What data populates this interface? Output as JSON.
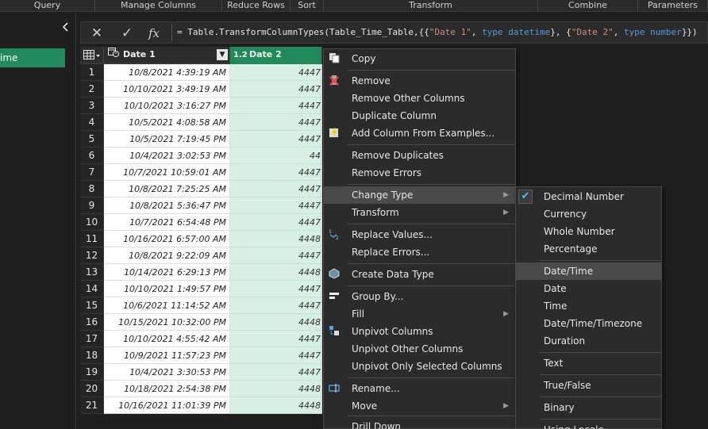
{
  "ribbon": {
    "groups": [
      "Query",
      "Manage Columns",
      "Reduce Rows",
      "Sort",
      "Transform",
      "Combine",
      "Parameters"
    ]
  },
  "queries": {
    "collapse_icon": "chevron-left",
    "selected_item": "ime"
  },
  "formula_bar": {
    "cancel_icon": "✕",
    "commit_icon": "✓",
    "fx_label": "fx",
    "eq": "=",
    "fn": "Table.TransformColumnTypes(Table_Time_Table,{{",
    "s1": "\"Date 1\"",
    "c1": ", ",
    "t1": "type datetime",
    "c2": "}, {",
    "s2": "\"Date 2\"",
    "c3": ", ",
    "t2": "type number",
    "c4": "}})"
  },
  "table": {
    "corner_icon": "table-menu-icon",
    "columns": [
      {
        "type_label": "",
        "name": "Date 1"
      },
      {
        "type_label": "1.2",
        "name": "Date 2"
      }
    ],
    "rows": [
      {
        "n": "1",
        "d1": "10/8/2021 4:39:19 AM",
        "d2": "4447"
      },
      {
        "n": "2",
        "d1": "10/10/2021 3:49:19 AM",
        "d2": "4447"
      },
      {
        "n": "3",
        "d1": "10/10/2021 3:16:27 PM",
        "d2": "4447"
      },
      {
        "n": "4",
        "d1": "10/5/2021 4:08:58 AM",
        "d2": "4447"
      },
      {
        "n": "5",
        "d1": "10/5/2021 7:19:45 PM",
        "d2": "4447"
      },
      {
        "n": "6",
        "d1": "10/4/2021 3:02:53 PM",
        "d2": "44"
      },
      {
        "n": "7",
        "d1": "10/7/2021 10:59:01 AM",
        "d2": "4447"
      },
      {
        "n": "8",
        "d1": "10/8/2021 7:25:25 AM",
        "d2": "4447"
      },
      {
        "n": "9",
        "d1": "10/8/2021 5:36:47 PM",
        "d2": "4447"
      },
      {
        "n": "10",
        "d1": "10/7/2021 6:54:48 PM",
        "d2": "4447"
      },
      {
        "n": "11",
        "d1": "10/16/2021 6:57:00 AM",
        "d2": "4448"
      },
      {
        "n": "12",
        "d1": "10/8/2021 9:22:09 AM",
        "d2": "4447"
      },
      {
        "n": "13",
        "d1": "10/14/2021 6:29:13 PM",
        "d2": "4448"
      },
      {
        "n": "14",
        "d1": "10/10/2021 1:49:57 PM",
        "d2": "4447"
      },
      {
        "n": "15",
        "d1": "10/6/2021 11:14:52 AM",
        "d2": "4447"
      },
      {
        "n": "16",
        "d1": "10/15/2021 10:32:00 PM",
        "d2": "4448"
      },
      {
        "n": "17",
        "d1": "10/10/2021 4:55:42 AM",
        "d2": "4447"
      },
      {
        "n": "18",
        "d1": "10/9/2021 11:57:23 PM",
        "d2": "4447"
      },
      {
        "n": "19",
        "d1": "10/4/2021 3:30:53 PM",
        "d2": "4447"
      },
      {
        "n": "20",
        "d1": "10/18/2021 2:54:38 PM",
        "d2": "4448"
      },
      {
        "n": "21",
        "d1": "10/16/2021 11:01:39 PM",
        "d2": "4448"
      }
    ]
  },
  "context_menu": {
    "items": [
      {
        "label": "Copy",
        "icon": "copy-icon"
      },
      {
        "label": "Remove",
        "icon": "remove-icon"
      },
      {
        "label": "Remove Other Columns",
        "icon": ""
      },
      {
        "label": "Duplicate Column",
        "icon": ""
      },
      {
        "label": "Add Column From Examples...",
        "icon": "examples-icon"
      },
      {
        "label": "Remove Duplicates",
        "icon": ""
      },
      {
        "label": "Remove Errors",
        "icon": ""
      },
      {
        "label": "Change Type",
        "icon": "",
        "submenu": true
      },
      {
        "label": "Transform",
        "icon": "",
        "submenu": true
      },
      {
        "label": "Replace Values...",
        "icon": "replace-values-icon"
      },
      {
        "label": "Replace Errors...",
        "icon": ""
      },
      {
        "label": "Create Data Type",
        "icon": "data-type-icon"
      },
      {
        "label": "Group By...",
        "icon": "group-by-icon"
      },
      {
        "label": "Fill",
        "icon": "",
        "submenu": true
      },
      {
        "label": "Unpivot Columns",
        "icon": "unpivot-icon"
      },
      {
        "label": "Unpivot Other Columns",
        "icon": ""
      },
      {
        "label": "Unpivot Only Selected Columns",
        "icon": ""
      },
      {
        "label": "Rename...",
        "icon": "rename-icon"
      },
      {
        "label": "Move",
        "icon": "",
        "submenu": true
      },
      {
        "label": "Drill Down",
        "icon": ""
      }
    ]
  },
  "change_type_submenu": {
    "checked": "Decimal Number",
    "highlighted": "Date/Time",
    "items": [
      {
        "label": "Decimal Number"
      },
      {
        "label": "Currency"
      },
      {
        "label": "Whole Number"
      },
      {
        "label": "Percentage"
      },
      {
        "label": "Date/Time"
      },
      {
        "label": "Date"
      },
      {
        "label": "Time"
      },
      {
        "label": "Date/Time/Timezone"
      },
      {
        "label": "Duration"
      },
      {
        "label": "Text"
      },
      {
        "label": "True/False"
      },
      {
        "label": "Binary"
      },
      {
        "label": "Using Locale..."
      }
    ]
  },
  "colors": {
    "accent_green": "#218a5a",
    "selected_column_bg": "#d8f0e4",
    "menu_bg": "#2b2b2b",
    "menu_highlight": "#4a4a4a"
  }
}
